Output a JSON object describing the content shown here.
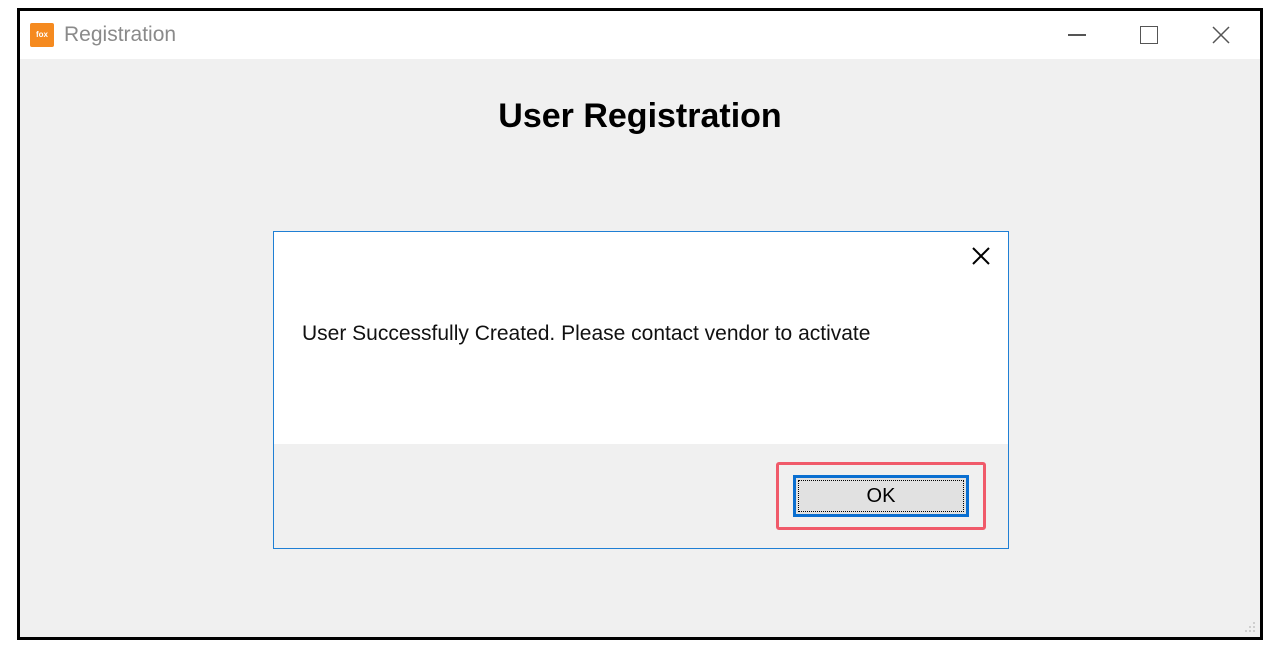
{
  "window": {
    "title": "Registration",
    "app_icon_text": "fox"
  },
  "page": {
    "heading": "User Registration"
  },
  "dialog": {
    "message": "User Successfully Created. Please contact vendor to activate",
    "ok_label": "OK"
  }
}
